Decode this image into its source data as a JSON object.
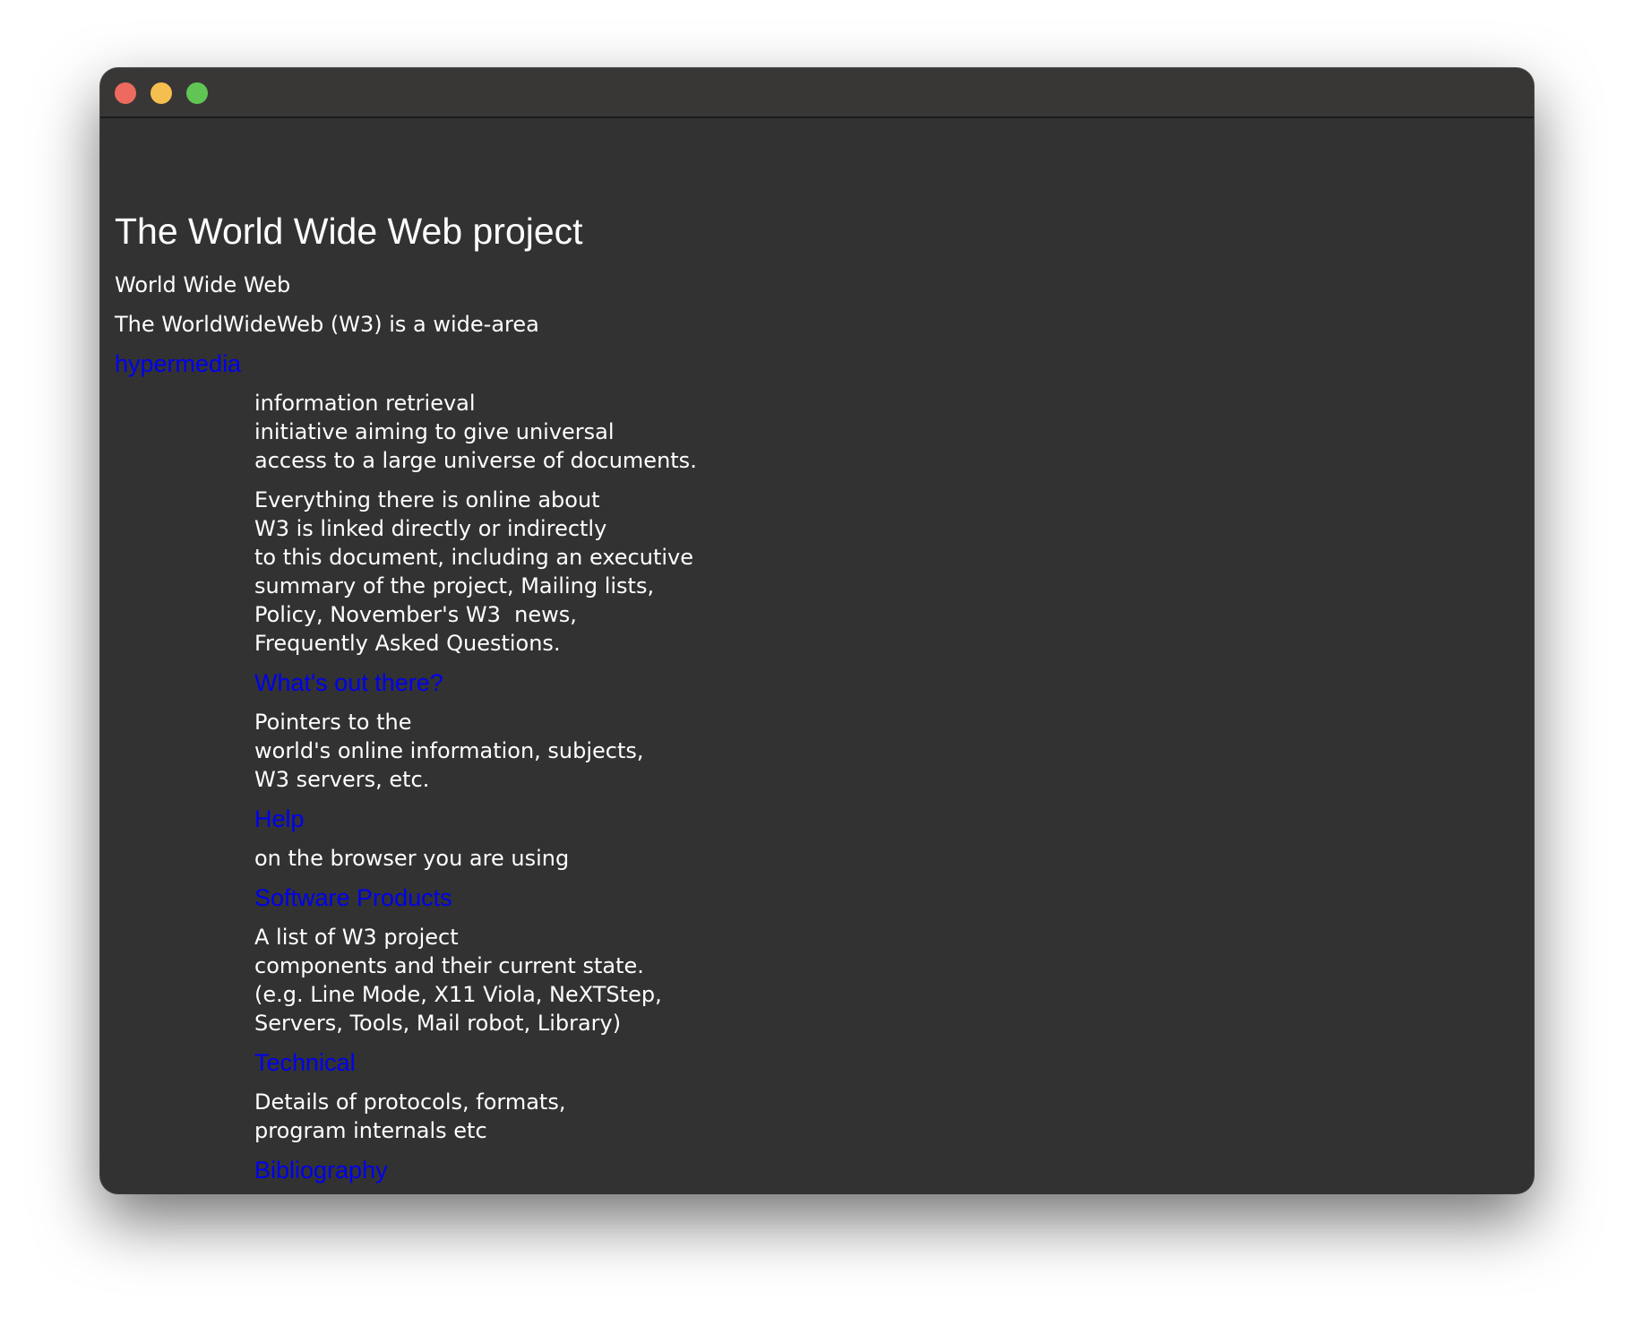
{
  "window": {
    "controls": {
      "close_color": "#ed6a5e",
      "minimize_color": "#f5bf4f",
      "maximize_color": "#61c554"
    }
  },
  "colors": {
    "background": "#323232",
    "text": "#ffffff",
    "link": "#0000ee"
  },
  "page": {
    "title": "The World Wide Web project",
    "subtitle": "World Wide Web",
    "intro": "The WorldWideWeb (W3) is a wide-area",
    "hypermedia_link": "hypermedia",
    "intro_continued": [
      "information retrieval",
      "initiative aiming to give universal",
      "access to a large universe of documents."
    ],
    "overview": [
      "Everything there is online about",
      "W3 is linked directly or indirectly",
      "to this document, including an executive",
      "summary of the project, Mailing lists,",
      "Policy, November's W3  news,",
      "Frequently Asked Questions."
    ],
    "sections": [
      {
        "link": "What's out there?",
        "description": [
          "Pointers to the",
          "world's online information, subjects,",
          "W3 servers, etc."
        ]
      },
      {
        "link": "Help",
        "description": [
          "on the browser you are using"
        ]
      },
      {
        "link": "Software Products",
        "description": [
          "A list of W3 project",
          "components and their current state.",
          "(e.g. Line Mode, X11 Viola, NeXTStep,",
          "Servers, Tools, Mail robot, Library)"
        ]
      },
      {
        "link": "Technical",
        "description": [
          "Details of protocols, formats,",
          "program internals etc"
        ]
      },
      {
        "link": "Bibliography",
        "description": []
      }
    ]
  }
}
